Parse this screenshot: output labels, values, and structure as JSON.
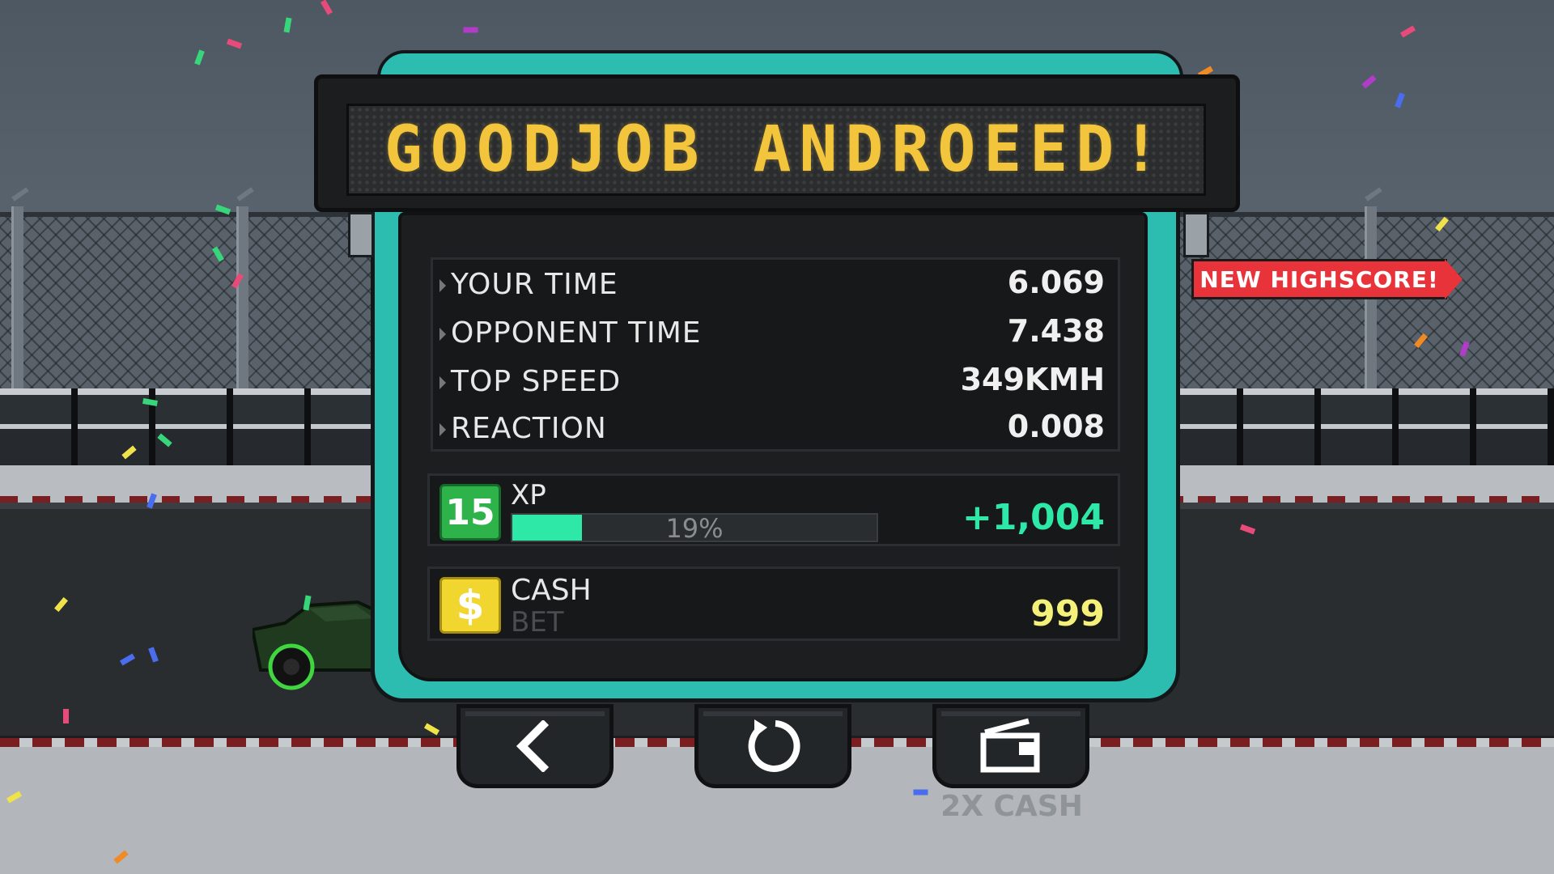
{
  "banner": {
    "text": "GOODJOB ANDROEED!"
  },
  "stats": [
    {
      "label": "YOUR TIME",
      "value": "6.069"
    },
    {
      "label": "OPPONENT TIME",
      "value": "7.438"
    },
    {
      "label": "TOP SPEED",
      "value": "349KMH"
    },
    {
      "label": "REACTION",
      "value": "0.008"
    }
  ],
  "xp": {
    "level": "15",
    "label": "XP",
    "progress_percent": 19,
    "progress_text": "19%",
    "gain": "+1,004"
  },
  "cash": {
    "icon_symbol": "$",
    "label": "CASH",
    "sub_label": "BET",
    "value": "999"
  },
  "highscore_ribbon": "NEW HIGHSCORE!",
  "buttons": {
    "back_icon": "chevron-left-icon",
    "retry_icon": "restart-icon",
    "video_icon": "video-camera-icon",
    "video_caption": "2X CASH"
  },
  "colors": {
    "panel_teal": "#2dbdb0",
    "marquee_text": "#f2c53d",
    "xp_green": "#2ee8a8",
    "level_badge": "#2db34a",
    "cash_yellow": "#f2d630",
    "cash_value": "#f4f07a",
    "ribbon_red": "#e8333b"
  }
}
